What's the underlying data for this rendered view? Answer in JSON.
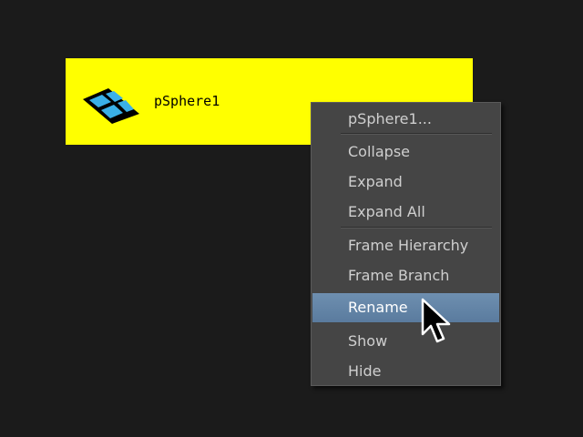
{
  "node": {
    "label": "pSphere1",
    "icon": "mesh-icon",
    "background": "#ffff00"
  },
  "context_menu": {
    "items": [
      {
        "label": "pSphere1..."
      },
      {
        "label": "Collapse"
      },
      {
        "label": "Expand"
      },
      {
        "label": "Expand All"
      },
      {
        "label": "Frame Hierarchy"
      },
      {
        "label": "Frame Branch"
      },
      {
        "label": "Rename",
        "highlighted": true
      },
      {
        "label": "Show"
      },
      {
        "label": "Hide"
      }
    ],
    "highlight_color": "#6383a6"
  },
  "cursor": {
    "icon": "mouse-pointer-icon"
  }
}
